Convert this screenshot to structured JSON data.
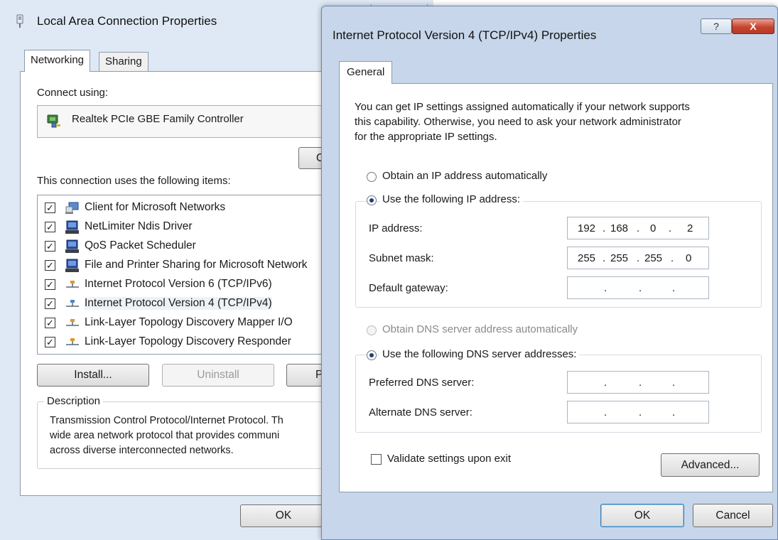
{
  "back_dialog": {
    "title": "Local Area Connection Properties",
    "close_glyph": "✕",
    "tabs": [
      "Networking",
      "Sharing"
    ],
    "connect_using_label": "Connect using:",
    "adapter_name": "Realtek PCIe GBE Family Controller",
    "configure_button_partial": "C",
    "items_label": "This connection uses the following items:",
    "items": [
      {
        "label": "Client for Microsoft Networks",
        "checked": true
      },
      {
        "label": "NetLimiter Ndis Driver",
        "checked": true
      },
      {
        "label": "QoS Packet Scheduler",
        "checked": true
      },
      {
        "label": "File and Printer Sharing for Microsoft Network",
        "checked": true
      },
      {
        "label": "Internet Protocol Version 6 (TCP/IPv6)",
        "checked": true
      },
      {
        "label": "Internet Protocol Version 4 (TCP/IPv4)",
        "checked": true,
        "selected": true
      },
      {
        "label": "Link-Layer Topology Discovery Mapper I/O",
        "checked": true
      },
      {
        "label": "Link-Layer Topology Discovery Responder",
        "checked": true
      }
    ],
    "install_button": "Install...",
    "uninstall_button": "Uninstall",
    "properties_button_partial": "P",
    "description_label": "Description",
    "description_lines": [
      "Transmission Control Protocol/Internet Protocol. Th",
      "wide area network protocol that provides communi",
      "across diverse interconnected networks."
    ],
    "ok_button": "OK",
    "check_glyph": "✓"
  },
  "front_dialog": {
    "title": "Internet Protocol Version 4 (TCP/IPv4) Properties",
    "help_glyph": "?",
    "close_glyph": "X",
    "tab": "General",
    "intro_lines": [
      "You can get IP settings assigned automatically if your network supports",
      "this capability. Otherwise, you need to ask your network administrator",
      "for the appropriate IP settings."
    ],
    "obtain_ip_auto": "Obtain an IP address automatically",
    "use_following_ip": "Use the following IP address:",
    "ip_address_label": "IP address:",
    "ip_address": [
      "192",
      "168",
      "0",
      "2"
    ],
    "subnet_mask_label": "Subnet mask:",
    "subnet_mask": [
      "255",
      "255",
      "255",
      "0"
    ],
    "default_gateway_label": "Default gateway:",
    "obtain_dns_auto": "Obtain DNS server address automatically",
    "use_following_dns": "Use the following DNS server addresses:",
    "preferred_dns_label": "Preferred DNS server:",
    "alternate_dns_label": "Alternate DNS server:",
    "validate_label": "Validate settings upon exit",
    "advanced_button": "Advanced...",
    "ok_button": "OK",
    "cancel_button": "Cancel",
    "dot": "."
  }
}
